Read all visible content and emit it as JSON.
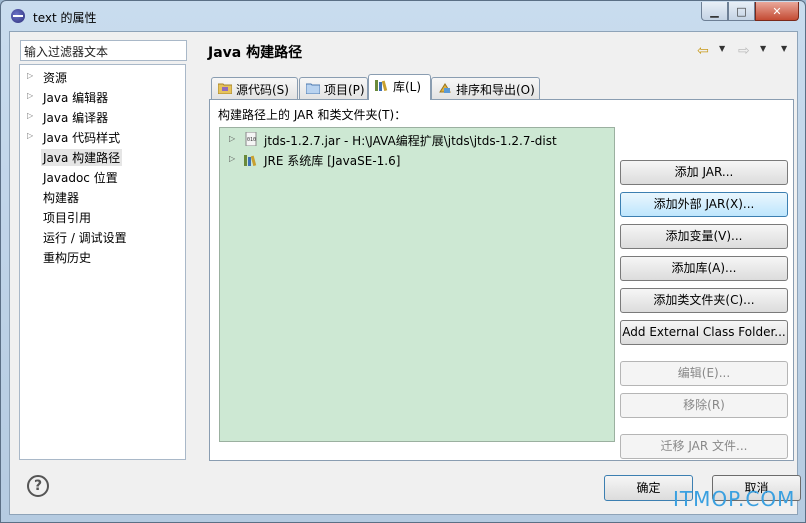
{
  "window": {
    "title": "text 的属性"
  },
  "filter": {
    "placeholder": "输入过滤器文本"
  },
  "tree": {
    "items": [
      {
        "label": "资源",
        "expandable": true
      },
      {
        "label": "Java 编辑器",
        "expandable": true
      },
      {
        "label": "Java 编译器",
        "expandable": true
      },
      {
        "label": "Java 代码样式",
        "expandable": true
      },
      {
        "label": "Java 构建路径",
        "expandable": false,
        "selected": true
      },
      {
        "label": "Javadoc 位置",
        "expandable": false
      },
      {
        "label": "构建器",
        "expandable": false
      },
      {
        "label": "项目引用",
        "expandable": false
      },
      {
        "label": "运行 / 调试设置",
        "expandable": false
      },
      {
        "label": "重构历史",
        "expandable": false
      }
    ]
  },
  "page": {
    "title": "Java 构建路径"
  },
  "tabs": [
    {
      "label": "源代码(S)",
      "icon": "source-folder-icon"
    },
    {
      "label": "项目(P)",
      "icon": "project-icon"
    },
    {
      "label": "库(L)",
      "icon": "library-icon",
      "active": true
    },
    {
      "label": "排序和导出(O)",
      "icon": "order-export-icon"
    }
  ],
  "libraries": {
    "caption": "构建路径上的 JAR 和类文件夹(T)：",
    "entries": [
      {
        "label": "jtds-1.2.7.jar  -  H:\\JAVA编程扩展\\jtds\\jtds-1.2.7-dist",
        "icon": "jar-icon"
      },
      {
        "label": "JRE 系统库 [JavaSE-1.6]",
        "icon": "jre-library-icon"
      }
    ]
  },
  "buttons": {
    "add_jar": "添加 JAR...",
    "add_external_jar": "添加外部 JAR(X)...",
    "add_variable": "添加变量(V)...",
    "add_library": "添加库(A)...",
    "add_class_folder": "添加类文件夹(C)...",
    "add_external_class_folder": "Add External Class Folder...",
    "edit": "编辑(E)...",
    "remove": "移除(R)",
    "migrate_jar": "迁移 JAR 文件..."
  },
  "footer": {
    "ok": "确定",
    "cancel": "取消"
  },
  "watermark": "ITMOP.COM",
  "colors": {
    "library_list_bg": "#cde8d3",
    "close_button": "#c44b33",
    "watermark": "#3aa0e0"
  }
}
